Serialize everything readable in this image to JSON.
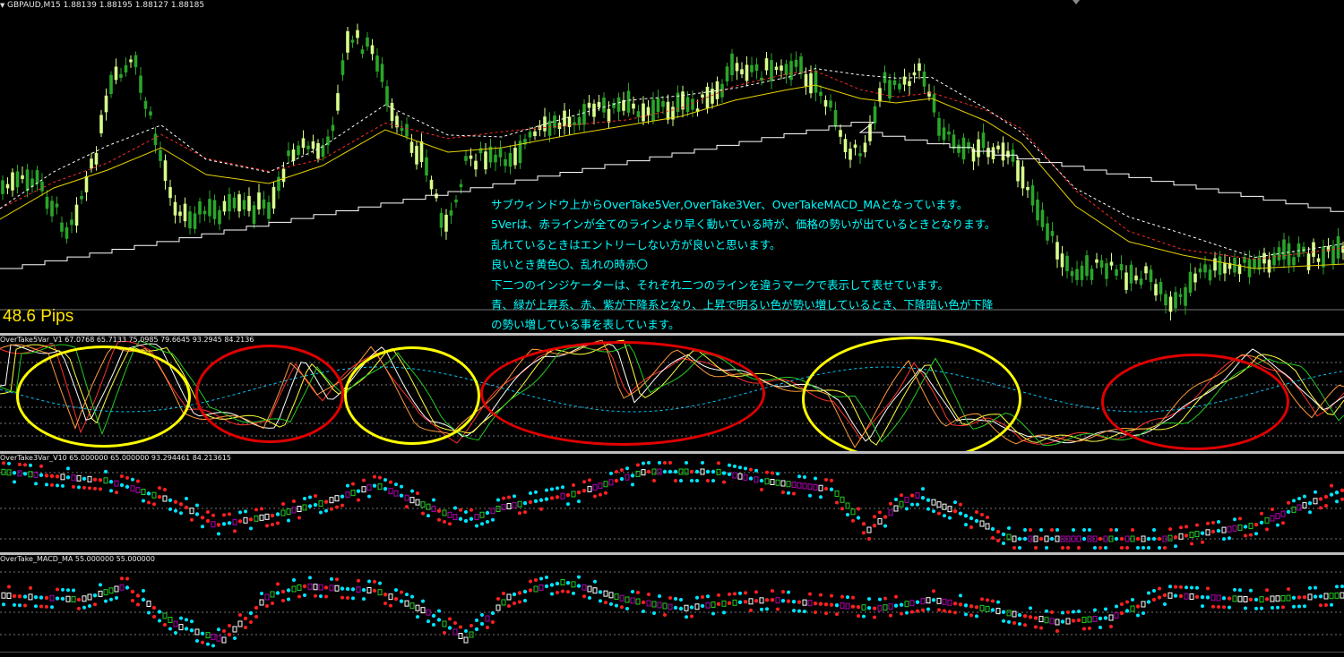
{
  "window": {
    "symbol_line": "GBPAUD,M15  1.88139 1.88195 1.88127 1.88185"
  },
  "main_chart": {
    "pips_label": "48.6 Pips",
    "note_lines": [
      "サブウィンドウ上からOverTake5Ver,OverTake3Ver、OverTakeMACD_MAとなっています。",
      "5Verは、赤ラインが全てのラインより早く動いている時が、価格の勢いが出ているときとなります。",
      "乱れているときはエントリーしない方が良いと思います。",
      "良いとき黄色〇、乱れの時赤〇",
      "下二つのインジケーターは、それぞれ二つのラインを違うマークで表示して表せています。",
      "青、緑が上昇系、赤、紫が下降系となり、上昇で明るい色が勢い増しているとき、下降暗い色が下降",
      "の勢い増している事を表しています。"
    ],
    "colors": {
      "bull_candle": "#d8ff8c",
      "bear_candle": "#2aa52a",
      "ma_yellow": "#e6d200",
      "ma_red": "#ff2a2a",
      "ma_white": "#ffffff",
      "band_white": "#ffffff",
      "text": "#00ffff",
      "pips": "#ffe600"
    }
  },
  "subwindow1": {
    "label": "OverTake5Var_V1 67.0768 65.7133 75.0985 79.6645 93.2945 84.2136",
    "circle_colors": {
      "good": "#ffff00",
      "bad": "#e00000"
    }
  },
  "subwindow2": {
    "label": "OverTake3Var_V10 65.000000 65.000000 93.294461 84.213615",
    "colors": {
      "bright_up": "#00e5ff",
      "up": "#22cc22",
      "down": "#ff2020",
      "down_dark": "#b000b0",
      "neutral": "#ffffff"
    }
  },
  "subwindow3": {
    "label": "OverTake_MACD_MA 55.000000 55.000000"
  }
}
